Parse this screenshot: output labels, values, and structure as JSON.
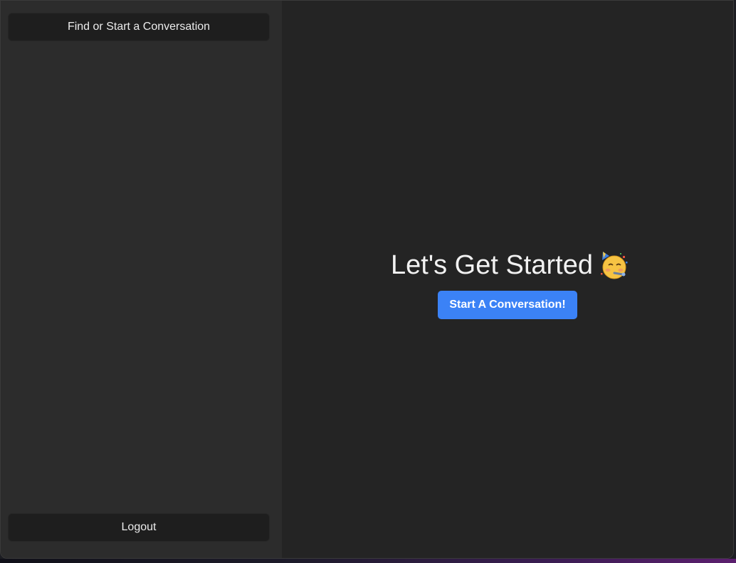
{
  "sidebar": {
    "find_button_label": "Find or Start a Conversation",
    "logout_button_label": "Logout"
  },
  "main": {
    "heading": "Let's Get Started",
    "heading_emoji": "partying-face-icon",
    "start_button_label": "Start A Conversation!"
  },
  "colors": {
    "accent": "#3b82f6",
    "sidebar_bg": "#2c2c2c",
    "main_bg": "#242424",
    "button_bg": "#1e1e1e"
  }
}
